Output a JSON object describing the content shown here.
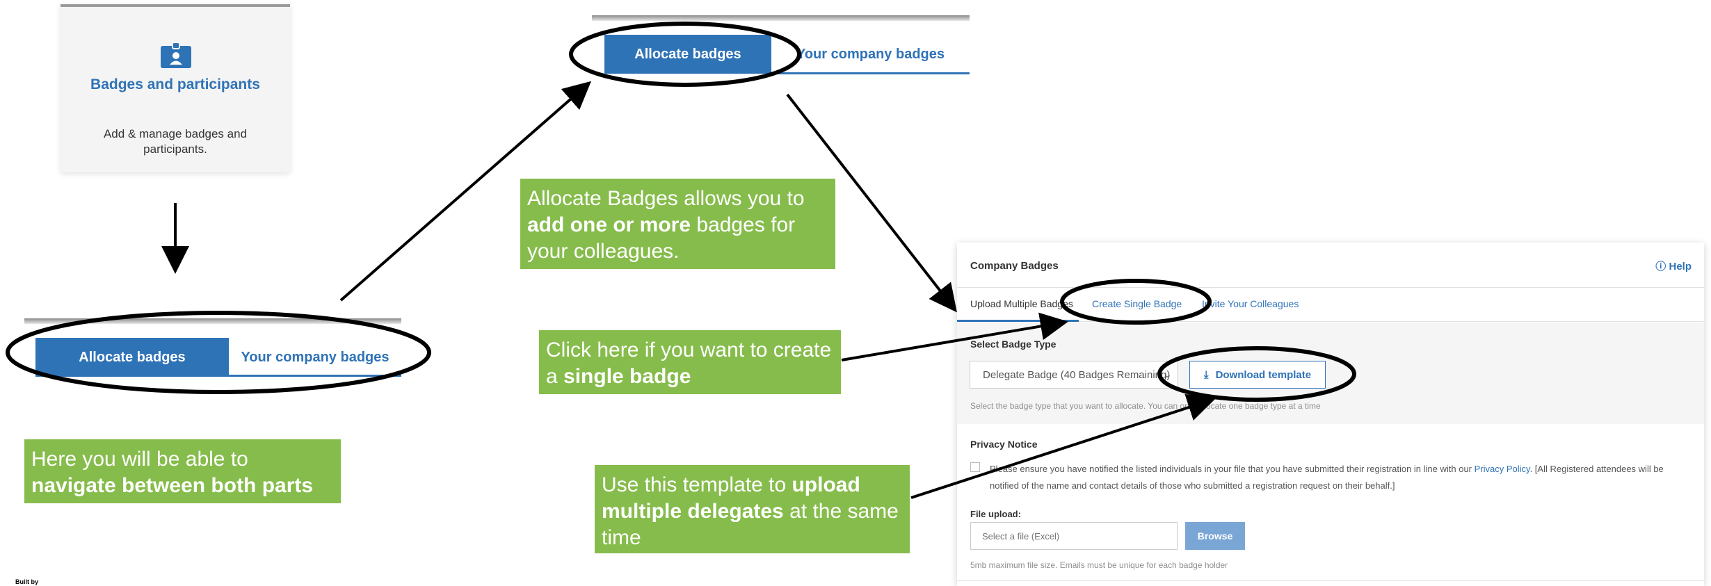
{
  "card": {
    "title": "Badges and participants",
    "description": "Add & manage badges and participants."
  },
  "tabs_first": {
    "active_label": "Allocate badges",
    "other_label": "Your company badges"
  },
  "tabs_second": {
    "active_label": "Allocate badges",
    "other_label": "Your company badges"
  },
  "callouts": {
    "allocate": {
      "pre": "Allocate Badges allows you to ",
      "bold": "add one or more",
      "post": " badges for your colleagues."
    },
    "navigate": {
      "pre": "Here you will be able to ",
      "bold": "navigate between both parts",
      "post": ""
    },
    "single": {
      "pre": "Click here if you want to create a ",
      "bold": "single badge",
      "post": ""
    },
    "template": {
      "pre": "Use this template to ",
      "bold": "upload multiple delegates",
      "post": " at the same time"
    }
  },
  "form": {
    "header": "Company Badges",
    "help_label": "Help",
    "tabs": [
      "Upload Multiple Badges",
      "Create Single Badge",
      "Invite Your Colleagues"
    ],
    "badge_type_label": "Select Badge Type",
    "badge_type_value": "Delegate Badge (40 Badges Remaining)",
    "download_label": "Download template",
    "badge_type_hint": "Select the badge type that you want to allocate. You can only allocate one badge type at a time",
    "privacy_title": "Privacy Notice",
    "privacy_text_1": "Please ensure you have notified the listed individuals in your file that you have submitted their registration in line with our ",
    "privacy_link": "Privacy Policy",
    "privacy_text_2": ". [All Registered attendees will be notified of the name and contact details of those who submitted a registration request on their behalf.]",
    "file_label": "File upload:",
    "file_placeholder": "Select a file (Excel)",
    "browse_label": "Browse",
    "file_hint": "5mb maximum file size. Emails must be unique for each badge holder"
  },
  "footer": {
    "mark": "Built by"
  },
  "colors": {
    "primary": "#2f73b7",
    "callout": "#86bc4b"
  }
}
